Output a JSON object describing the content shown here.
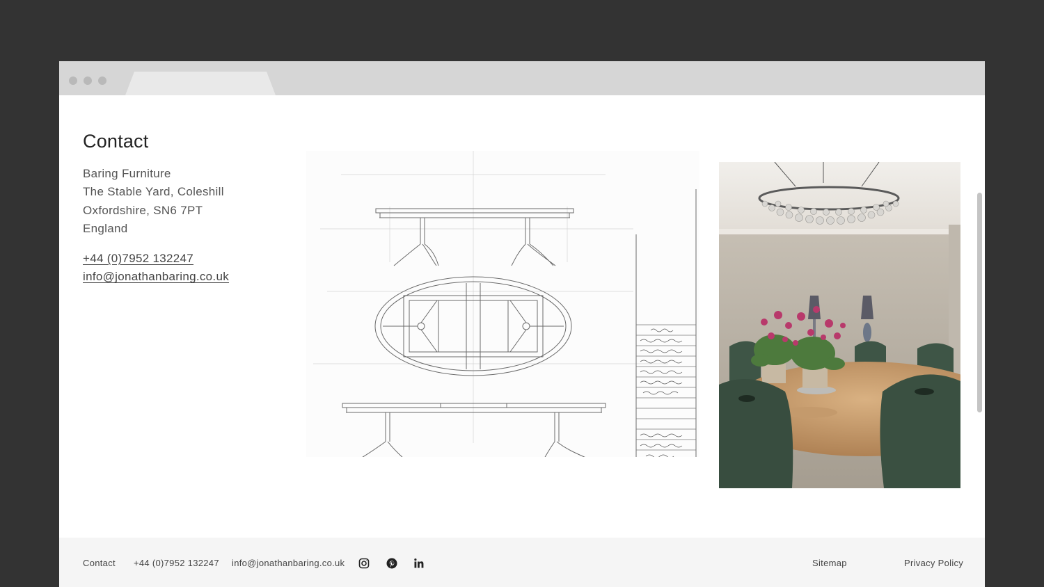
{
  "page": {
    "title": "Contact",
    "address_lines": [
      "Baring Furniture",
      "The Stable Yard, Coleshill",
      "Oxfordshire, SN6 7PT",
      "England"
    ],
    "phone": "+44 (0)7952 132247",
    "email": "info@jonathanbaring.co.uk"
  },
  "footer": {
    "contact_label": "Contact",
    "phone": "+44 (0)7952 132247",
    "email": "info@jonathanbaring.co.uk",
    "icons": [
      "instagram-icon",
      "pinterest-icon",
      "linkedin-icon"
    ],
    "sitemap_label": "Sitemap",
    "privacy_label": "Privacy Policy"
  },
  "colors": {
    "outer_background": "#333333",
    "browser_chrome": "#d6d6d6",
    "footer_background": "#f5f5f5",
    "text": "#555555"
  }
}
